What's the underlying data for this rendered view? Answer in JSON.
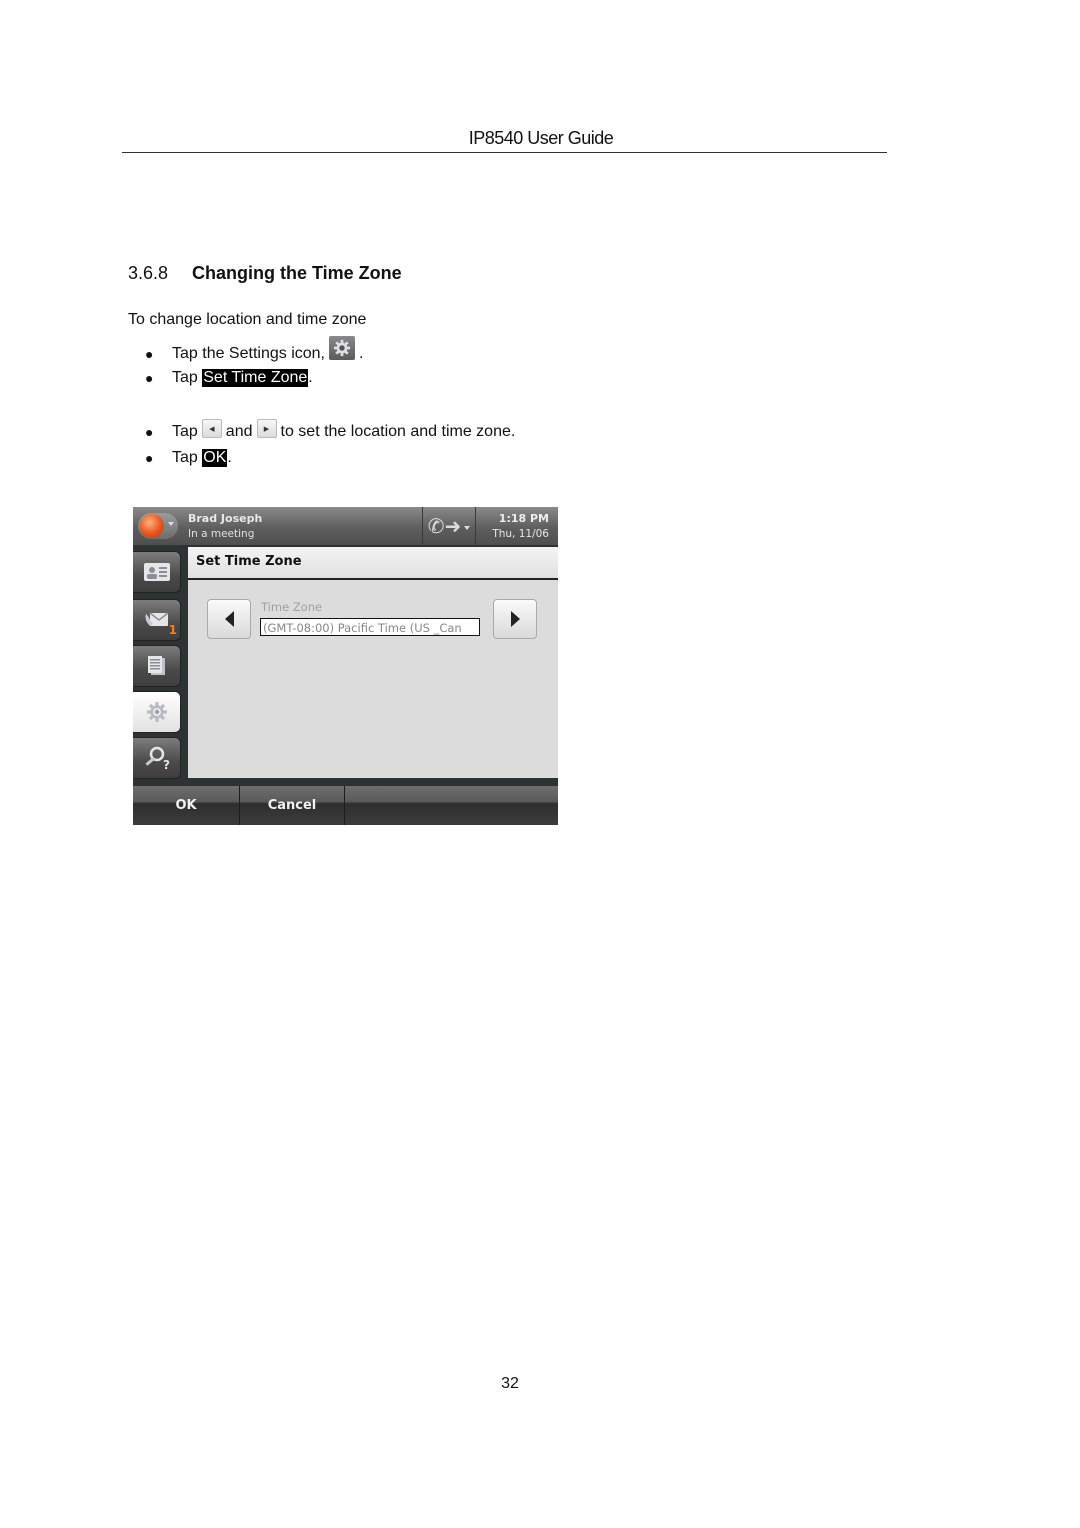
{
  "header": {
    "title": "IP8540 User Guide"
  },
  "section": {
    "number": "3.6.8",
    "title": "Changing the Time Zone"
  },
  "intro": "To change location and time zone",
  "steps": [
    {
      "pre": "Tap the Settings icon,",
      "icon": "settings-gear-icon",
      "post": "."
    },
    {
      "pre": "Tap",
      "highlight": "Set Time Zone",
      "post": "."
    },
    {
      "pre": "Tap",
      "icon_left": "left-arrow-icon",
      "mid": "and",
      "icon_right": "right-arrow-icon",
      "post": "to set the location and time zone."
    },
    {
      "pre": "Tap",
      "highlight": "OK",
      "post": "."
    }
  ],
  "screenshot": {
    "status": {
      "user_name": "Brad Joseph",
      "user_status": "In a meeting",
      "time": "1:18 PM",
      "date": "Thu, 11/06",
      "presence_color": "#e8541c"
    },
    "nav": [
      {
        "name": "contacts",
        "icon": "contact-card-icon"
      },
      {
        "name": "messages",
        "icon": "voicemail-icon",
        "badge": "1"
      },
      {
        "name": "directory",
        "icon": "directory-icon"
      },
      {
        "name": "settings",
        "icon": "gear-icon",
        "active": true
      },
      {
        "name": "search-help",
        "icon": "search-help-icon"
      }
    ],
    "panel": {
      "title": "Set Time Zone",
      "field_label": "Time Zone",
      "field_value": "(GMT-08:00) Pacific Time (US _Can"
    },
    "softkeys": {
      "ok": "OK",
      "cancel": "Cancel"
    }
  },
  "page_number": "32"
}
